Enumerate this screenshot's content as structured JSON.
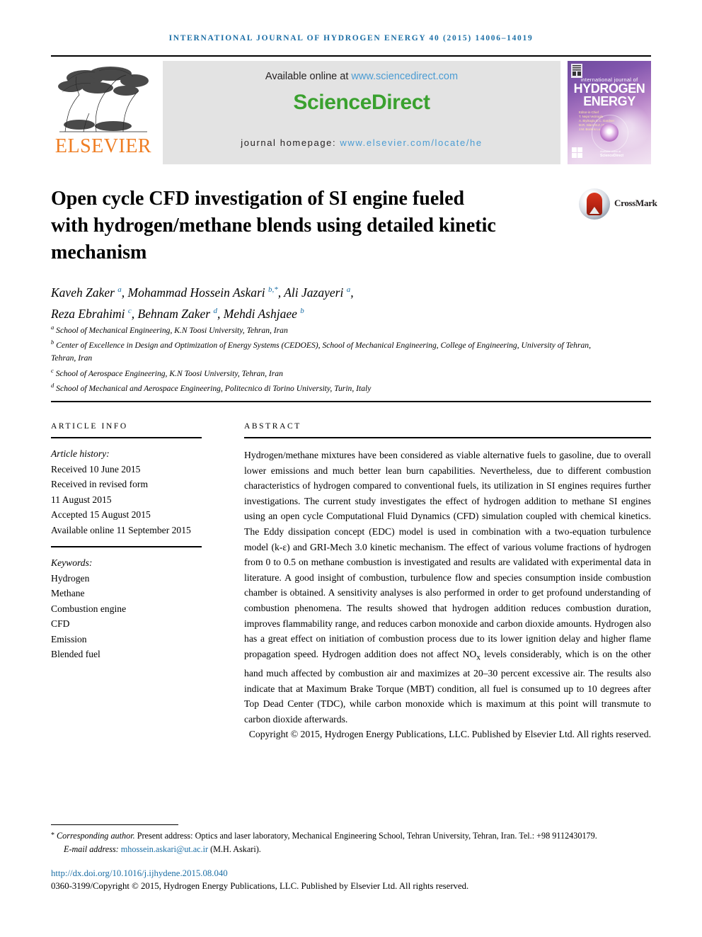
{
  "running_head": "International Journal of Hydrogen Energy 40 (2015) 14006–14019",
  "banner": {
    "publisher_name": "ELSEVIER",
    "available_prefix": "Available online at ",
    "sciencedirect_url": "www.sciencedirect.com",
    "sciencedirect_logo": "ScienceDirect",
    "homepage_prefix": "journal homepage: ",
    "homepage_url": "www.elsevier.com/locate/he",
    "cover": {
      "line_small": "international journal of",
      "line1": "HYDROGEN",
      "line2": "ENERGY",
      "editors": "Editor-in-Chief  T. Nejat Veziroglu\nAssociate Editors  A. Biyikoglu, E.C. Gardner, M.R. Islam, M.Z. Hyseni, J.M. Bockris, Lu Chun Tsai, D.Y. Goswami",
      "sd_mark": "ScienceDirect"
    }
  },
  "crossmark": {
    "label": "CrossMark"
  },
  "article": {
    "title": "Open cycle CFD investigation of SI engine fueled with hydrogen/methane blends using detailed kinetic mechanism",
    "authors_line1": "Kaveh Zaker <sup>a</sup>, Mohammad Hossein Askari <sup>b,*</sup>, Ali Jazayeri <sup>a</sup>,",
    "authors_line2": "Reza Ebrahimi <sup>c</sup>, Behnam Zaker <sup>d</sup>, Mehdi Ashjaee <sup>b</sup>",
    "affiliations": [
      {
        "mark": "a",
        "text": "School of Mechanical Engineering, K.N Toosi University, Tehran, Iran"
      },
      {
        "mark": "b",
        "text": "Center of Excellence in Design and Optimization of Energy Systems (CEDOES), School of Mechanical Engineering, College of Engineering, University of Tehran, Tehran, Iran"
      },
      {
        "mark": "c",
        "text": "School of Aerospace Engineering, K.N Toosi University, Tehran, Iran"
      },
      {
        "mark": "d",
        "text": "School of Mechanical and Aerospace Engineering, Politecnico di Torino University, Turin, Italy"
      }
    ]
  },
  "article_info": {
    "heading": "ARTICLE INFO",
    "history_label": "Article history:",
    "history": [
      "Received 10 June 2015",
      "Received in revised form",
      "11 August 2015",
      "Accepted 15 August 2015",
      "Available online 11 September 2015"
    ],
    "keywords_label": "Keywords:",
    "keywords": [
      "Hydrogen",
      "Methane",
      "Combustion engine",
      "CFD",
      "Emission",
      "Blended fuel"
    ]
  },
  "abstract": {
    "heading": "ABSTRACT",
    "body": "Hydrogen/methane mixtures have been considered as viable alternative fuels to gasoline, due to overall lower emissions and much better lean burn capabilities. Nevertheless, due to different combustion characteristics of hydrogen compared to conventional fuels, its utilization in SI engines requires further investigations. The current study investigates the effect of hydrogen addition to methane SI engines using an open cycle Computational Fluid Dynamics (CFD) simulation coupled with chemical kinetics. The Eddy dissipation concept (EDC) model is used in combination with a two-equation turbulence model (k-ε) and GRI-Mech 3.0 kinetic mechanism. The effect of various volume fractions of hydrogen from 0 to 0.5 on methane combustion is investigated and results are validated with experimental data in literature. A good insight of combustion, turbulence flow and species consumption inside combustion chamber is obtained. A sensitivity analyses is also performed in order to get profound understanding of combustion phenomena. The results showed that hydrogen addition reduces combustion duration, improves flammability range, and reduces carbon monoxide and carbon dioxide amounts. Hydrogen also has a great effect on initiation of combustion process due to its lower ignition delay and higher flame propagation speed. Hydrogen addition does not affect NO<sub>x</sub> levels considerably, which is on the other hand much affected by combustion air and maximizes at 20–30 percent excessive air. The results also indicate that at Maximum Brake Torque (MBT) condition, all fuel is consumed up to 10 degrees after Top Dead Center (TDC), while carbon monoxide which is maximum at this point will transmute to carbon dioxide afterwards.",
    "copyright": "Copyright © 2015, Hydrogen Energy Publications, LLC. Published by Elsevier Ltd. All rights reserved."
  },
  "footer": {
    "corresponding_label": "Corresponding author.",
    "corresponding_text": " Present address: Optics and laser laboratory, Mechanical Engineering School, Tehran University, Tehran, Iran. Tel.: +98 9112430179.",
    "email_label": "E-mail address: ",
    "email": "mhossein.askari@ut.ac.ir",
    "email_suffix": " (M.H. Askari).",
    "doi": "http://dx.doi.org/10.1016/j.ijhydene.2015.08.040",
    "issn_copyright": "0360-3199/Copyright © 2015, Hydrogen Energy Publications, LLC. Published by Elsevier Ltd. All rights reserved."
  },
  "colors": {
    "journal_blue": "#1b6ea5",
    "link_blue": "#4b9cd3",
    "sciencedirect_green": "#3aa12f",
    "elsevier_orange": "#ef7d22"
  }
}
